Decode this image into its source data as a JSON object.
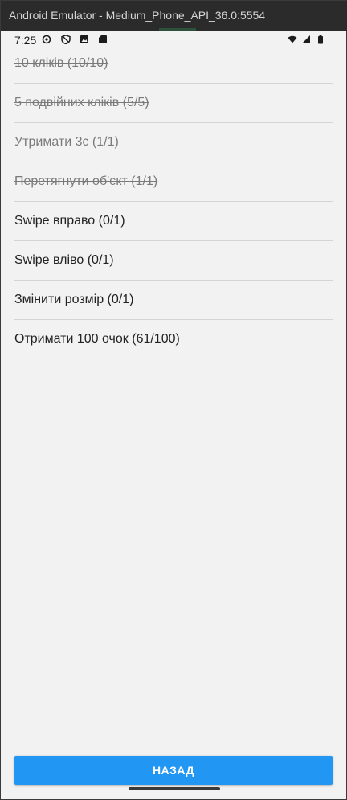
{
  "window": {
    "title": "Android Emulator - Medium_Phone_API_36.0:5554"
  },
  "statusbar": {
    "time": "7:25",
    "left_icons": [
      "settings-icon",
      "shield-icon",
      "image-icon",
      "sd-card-icon"
    ],
    "right_icons": [
      "wifi-icon",
      "signal-icon",
      "battery-icon"
    ]
  },
  "tasks": [
    {
      "label": "10 кліків (10/10)",
      "done": true
    },
    {
      "label": "5 подвійних кліків (5/5)",
      "done": true
    },
    {
      "label": "Утримати 3с (1/1)",
      "done": true
    },
    {
      "label": "Перетягнути об'єкт (1/1)",
      "done": true
    },
    {
      "label": "Swipe вправо (0/1)",
      "done": false
    },
    {
      "label": "Swipe вліво (0/1)",
      "done": false
    },
    {
      "label": "Змінити розмір (0/1)",
      "done": false
    },
    {
      "label": "Отримати 100 очок (61/100)",
      "done": false
    }
  ],
  "back_button": {
    "label": "НАЗАД"
  },
  "colors": {
    "accent": "#2196f3",
    "completed_text": "#7a7a7a",
    "active_text": "#222222"
  }
}
